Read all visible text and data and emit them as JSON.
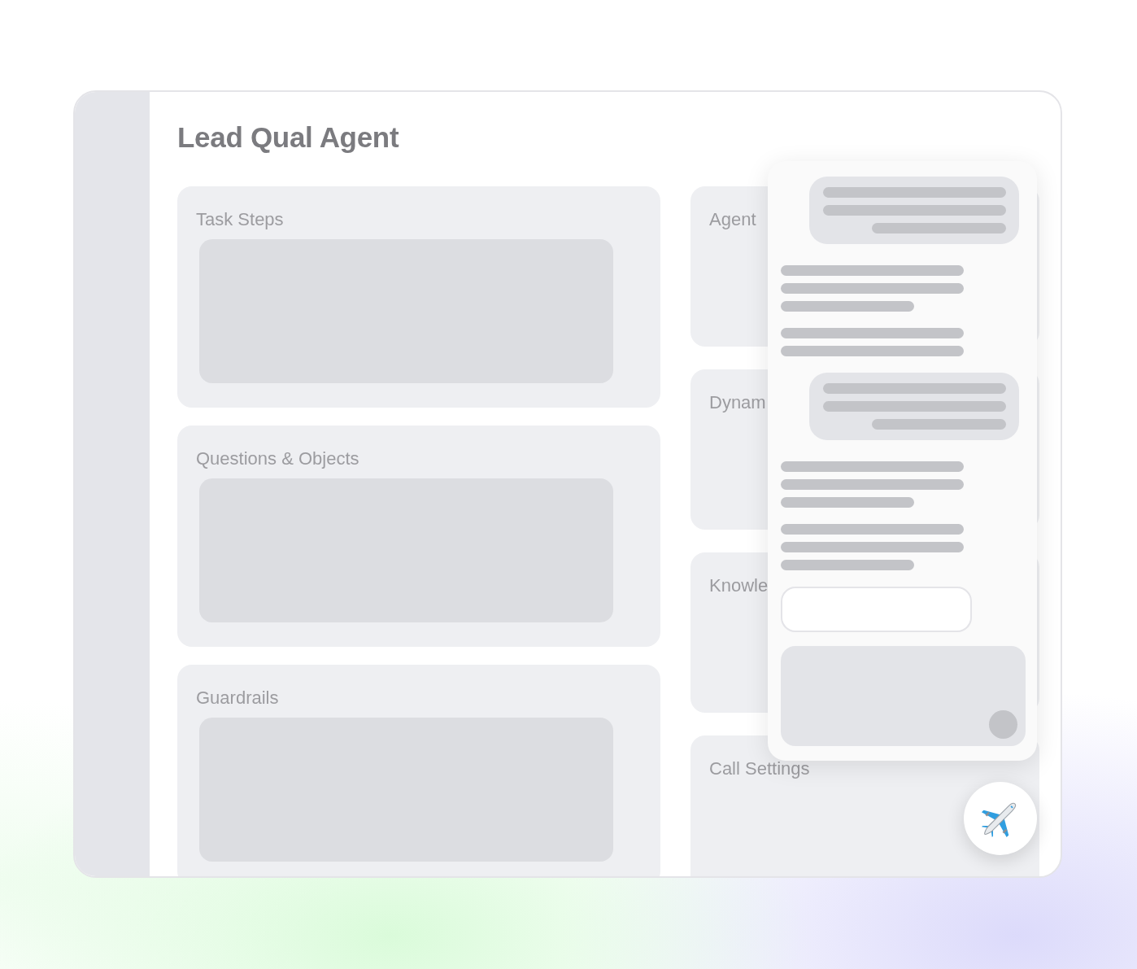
{
  "page": {
    "title": "Lead Qual Agent"
  },
  "left_sections": [
    {
      "title": "Task Steps"
    },
    {
      "title": "Questions & Objects"
    },
    {
      "title": "Guardrails"
    }
  ],
  "right_sections": [
    {
      "title": "Agent"
    },
    {
      "title": "Dynam"
    },
    {
      "title": "Knowle"
    },
    {
      "title": "Call Settings"
    }
  ],
  "chat_panel": {
    "messages": [
      {
        "kind": "user",
        "lines": [
          {
            "level": 1
          },
          {
            "level": 1
          },
          {
            "level": 0.73
          }
        ]
      },
      {
        "kind": "assistant",
        "lines": [
          {
            "level": 1
          },
          {
            "level": 1
          },
          {
            "level": 0.73
          }
        ]
      },
      {
        "kind": "assistant",
        "lines": [
          {
            "level": 1
          },
          {
            "level": 1
          }
        ]
      },
      {
        "kind": "user",
        "lines": [
          {
            "level": 1
          },
          {
            "level": 1
          },
          {
            "level": 0.73
          }
        ]
      },
      {
        "kind": "assistant",
        "lines": [
          {
            "level": 1
          },
          {
            "level": 1
          },
          {
            "level": 0.73
          }
        ]
      },
      {
        "kind": "assistant",
        "lines": [
          {
            "level": 1
          },
          {
            "level": 1
          },
          {
            "level": 0.73
          }
        ]
      }
    ]
  }
}
